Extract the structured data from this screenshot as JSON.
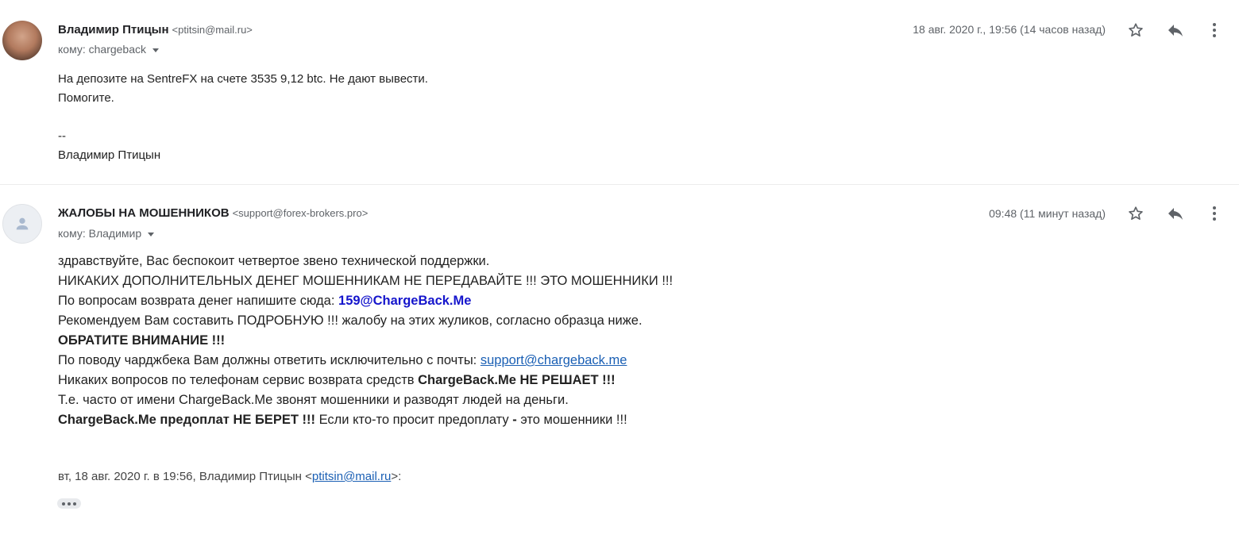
{
  "messages": [
    {
      "sender_name": "Владимир Птицын",
      "sender_email": "<ptitsin@mail.ru>",
      "to": "кому: chargeback",
      "date": "18 авг. 2020 г., 19:56 (14 часов назад)",
      "body": {
        "line1": "На депозите на SentreFX на счете 3535  9,12 btc. Не дают вывести.",
        "line2": "Помогите.",
        "sig_sep": "--",
        "sig_name": "Владимир Птицын"
      }
    },
    {
      "sender_name": "ЖАЛОБЫ НА МОШЕННИКОВ",
      "sender_email": "<support@forex-brokers.pro>",
      "to": "кому: Владимир",
      "date": "09:48 (11 минут назад)",
      "body": {
        "l1": "здравствуйте, Вас беспокоит четвертое звено технической поддержки.",
        "l2": "НИКАКИХ ДОПОЛНИТЕЛЬНЫХ ДЕНЕГ МОШЕННИКАМ НЕ ПЕРЕДАВАЙТЕ !!! ЭТО МОШЕННИКИ !!!",
        "l3_text": "По вопросам возврата денег напишите сюда: ",
        "l3_email": "159@ChargeBack.Me",
        "l4": "Рекомендуем Вам составить ПОДРОБНУЮ !!! жалобу на этих жуликов, согласно образца ниже.",
        "l5": "ОБРАТИТЕ ВНИМАНИЕ !!!",
        "l6_text": "По поводу чарджбека Вам должны ответить исключительно с почты: ",
        "l6_link": "support@chargeback.me",
        "l7_text": "Никаких вопросов по телефонам сервис возврата средств ",
        "l7_bold": "ChargeBack.Me НЕ РЕШАЕТ !!!",
        "l8": "Т.е. часто от имени ChargeBack.Me звонят мошенники и разводят людей на деньги.",
        "l9_bold": "ChargeBack.Me предоплат НЕ БЕРЕТ !!!",
        "l9_text": " Если кто-то просит предоплату ",
        "l9_dash": "-",
        "l9_end": " это мошенники !!!"
      },
      "quote": {
        "prefix": "вт, 18 авг. 2020 г. в 19:56, Владимир Птицын <",
        "email": "ptitsin@mail.ru",
        "suffix": ">:"
      }
    }
  ],
  "icons": [
    "star-icon",
    "reply-icon",
    "more-vert-icon",
    "person-icon",
    "ellipsis-icon",
    "caret-down-icon"
  ]
}
